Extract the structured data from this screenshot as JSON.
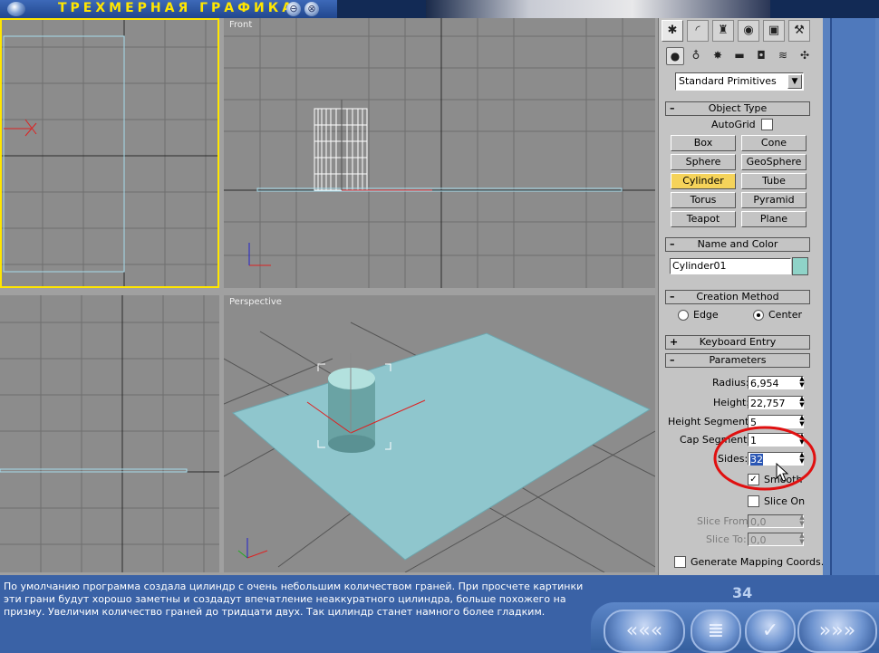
{
  "window": {
    "title": "ТРЕХМЕРНАЯ ГРАФИКА",
    "minimize_glyph": "⊖",
    "close_glyph": "⊗"
  },
  "viewports": {
    "front_label": "Front",
    "perspective_label": "Perspective"
  },
  "command_panel": {
    "tabs": [
      {
        "icon": "create-icon",
        "glyph": "✱",
        "active": true
      },
      {
        "icon": "modify-icon",
        "glyph": "◜"
      },
      {
        "icon": "hierarchy-icon",
        "glyph": "♜"
      },
      {
        "icon": "motion-icon",
        "glyph": "◉"
      },
      {
        "icon": "display-icon",
        "glyph": "▣"
      },
      {
        "icon": "utilities-icon",
        "glyph": "⚒"
      }
    ],
    "subcategories": [
      {
        "icon": "geometry-icon",
        "glyph": "●",
        "active": true
      },
      {
        "icon": "shapes-icon",
        "glyph": "♁"
      },
      {
        "icon": "lights-icon",
        "glyph": "✸"
      },
      {
        "icon": "cameras-icon",
        "glyph": "▬"
      },
      {
        "icon": "helpers-icon",
        "glyph": "◘"
      },
      {
        "icon": "spacewarps-icon",
        "glyph": "≋"
      },
      {
        "icon": "systems-icon",
        "glyph": "✣"
      }
    ],
    "dropdown_value": "Standard Primitives",
    "object_type": {
      "header": "Object Type",
      "autogrid_label": "AutoGrid",
      "buttons": [
        "Box",
        "Cone",
        "Sphere",
        "GeoSphere",
        "Cylinder",
        "Tube",
        "Torus",
        "Pyramid",
        "Teapot",
        "Plane"
      ],
      "selected": "Cylinder"
    },
    "name_and_color": {
      "header": "Name and Color",
      "name_value": "Cylinder01",
      "swatch_color": "#8fd3c8"
    },
    "creation_method": {
      "header": "Creation Method",
      "options": [
        "Edge",
        "Center"
      ],
      "selected": "Center"
    },
    "keyboard_entry": {
      "header": "Keyboard Entry"
    },
    "parameters": {
      "header": "Parameters",
      "radius_label": "Radius:",
      "radius_value": "6,954",
      "height_label": "Height:",
      "height_value": "22,757",
      "height_segments_label": "Height Segments:",
      "height_segments_value": "5",
      "cap_segments_label": "Cap Segments:",
      "cap_segments_value": "1",
      "sides_label": "Sides:",
      "sides_value": "32",
      "smooth_label": "Smooth",
      "smooth_checked": true,
      "slice_on_label": "Slice On",
      "slice_from_label": "Slice From:",
      "slice_from_value": "0,0",
      "slice_to_label": "Slice To:",
      "slice_to_value": "0,0",
      "mapping_label": "Generate Mapping Coords."
    }
  },
  "bottom": {
    "description": "По умолчанию программа создала цилиндр с очень небольшим количеством граней. При просчете картинки эти грани будут хорошо заметны и создадут впечатление неаккуратного цилиндра, больше похожего на призму. Увеличим количество граней до тридцати двух. Так цилиндр станет намного более гладким.",
    "page_number": "34",
    "nav": {
      "back_glyph": "«««",
      "contents_glyph": "≣",
      "check_glyph": "✓",
      "forward_glyph": "»»»"
    }
  },
  "colors": {
    "accent_highlight": "#ff0000",
    "selected_button": "#f5d35a",
    "active_viewport_border": "#ffe600"
  }
}
